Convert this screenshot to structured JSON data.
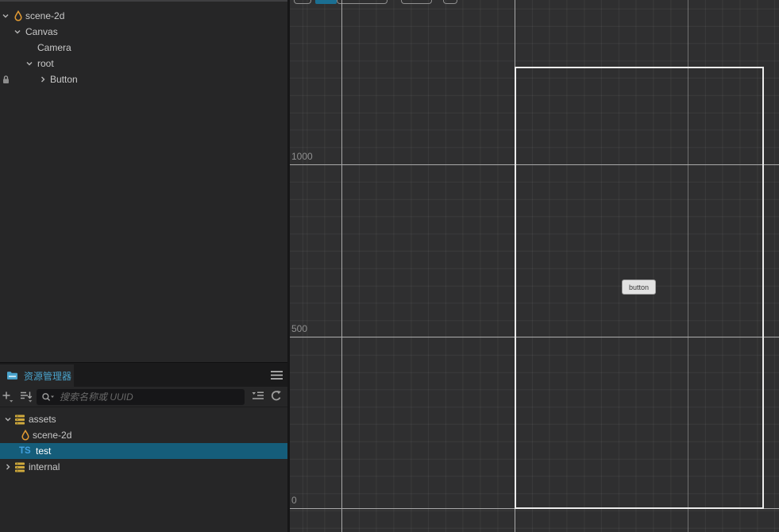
{
  "colors": {
    "accent-teal": "#1b6f92",
    "selection-bg": "#155d7a",
    "panel-accent": "#4aa3cc",
    "ts-blue": "#42a0e0",
    "asset-yellow": "#cfa93d",
    "scene-icon-orange": "#e39b33",
    "grid-major": "#a8a8a8",
    "canvas-outline": "#ececec"
  },
  "hierarchy": {
    "items": [
      {
        "label": "scene-2d",
        "expanded": true
      },
      {
        "label": "Canvas",
        "expanded": true
      },
      {
        "label": "Camera"
      },
      {
        "label": "root",
        "expanded": true
      },
      {
        "label": "Button",
        "collapsed": true,
        "locked": true
      }
    ]
  },
  "assets": {
    "tab_title": "资源管理器",
    "search_placeholder": "搜索名称或 UUID",
    "items": [
      {
        "label": "assets",
        "expanded": true
      },
      {
        "label": "scene-2d"
      },
      {
        "label": "test",
        "badge": "TS",
        "selected": true
      },
      {
        "label": "internal",
        "collapsed": true
      }
    ]
  },
  "scene": {
    "ruler_labels": [
      "1000",
      "500",
      "0"
    ],
    "button_label": "button"
  }
}
